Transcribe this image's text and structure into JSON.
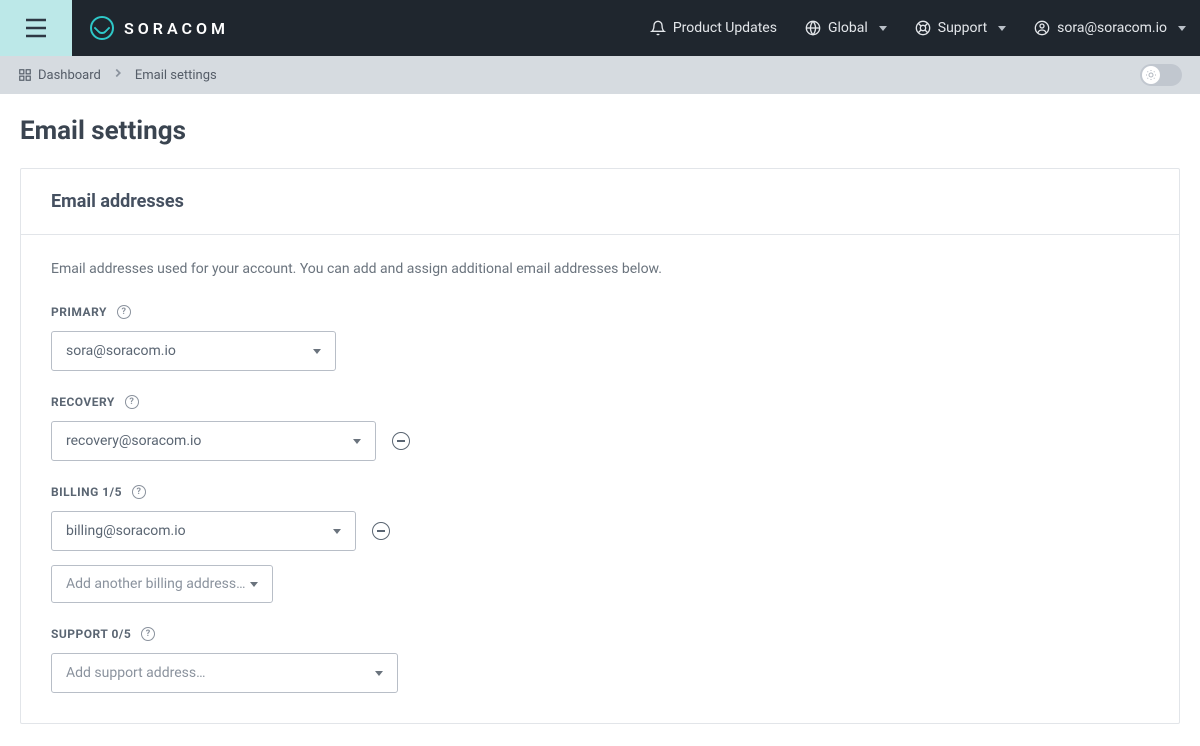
{
  "brand": {
    "name": "SORACOM"
  },
  "nav": {
    "product_updates": "Product Updates",
    "global": "Global",
    "support": "Support",
    "account": "sora@soracom.io"
  },
  "breadcrumb": {
    "dashboard": "Dashboard",
    "current": "Email settings"
  },
  "page": {
    "title": "Email settings"
  },
  "card": {
    "header": "Email addresses",
    "description": "Email addresses used for your account. You can add and assign additional email addresses below.",
    "fields": {
      "primary": {
        "label": "PRIMARY",
        "value": "sora@soracom.io"
      },
      "recovery": {
        "label": "RECOVERY",
        "value": "recovery@soracom.io"
      },
      "billing": {
        "label": "BILLING 1/5",
        "value": "billing@soracom.io",
        "add_label": "Add another billing address…"
      },
      "support": {
        "label": "SUPPORT 0/5",
        "placeholder": "Add support address…"
      }
    }
  }
}
